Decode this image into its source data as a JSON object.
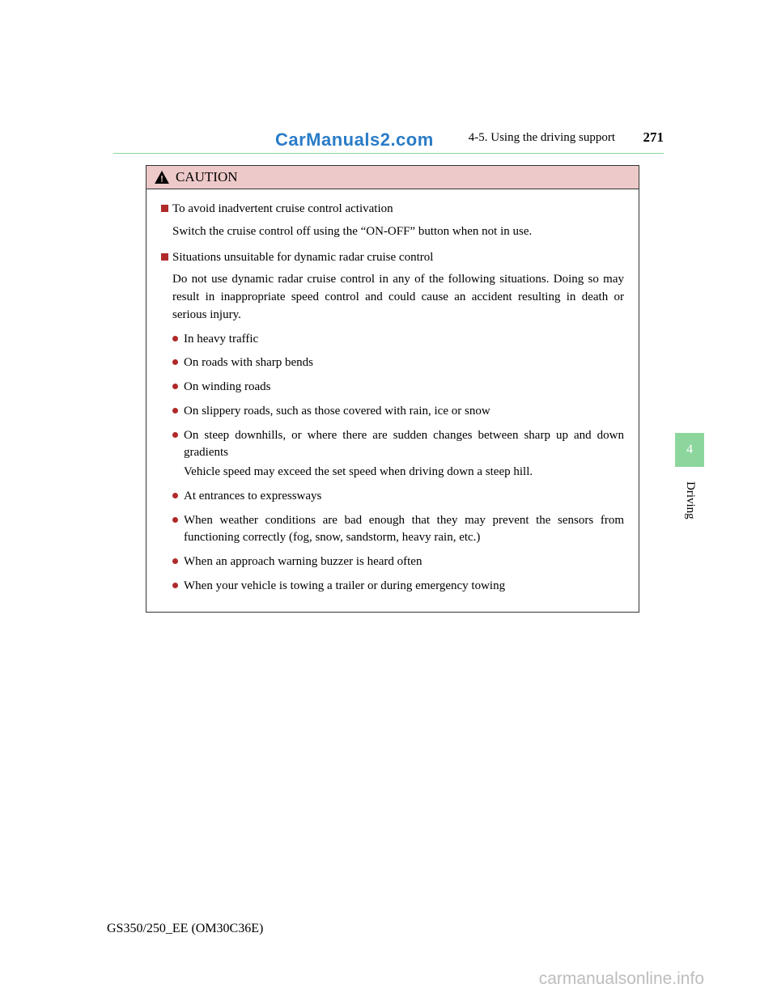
{
  "header": {
    "watermark": "CarManuals2.com",
    "section": "4-5. Using the driving support",
    "page_number": "271"
  },
  "caution": {
    "title": "CAUTION",
    "sections": [
      {
        "heading": "To avoid inadvertent cruise control activation",
        "paragraph": "Switch the cruise control off using the “ON-OFF” button when not in use."
      },
      {
        "heading": "Situations unsuitable for dynamic radar cruise control",
        "paragraph": "Do not use dynamic radar cruise control in any of the following situations. Doing so may result in inappropriate speed control and could cause an accident resulting in death or serious injury.",
        "bullets": [
          {
            "text": "In heavy traffic"
          },
          {
            "text": "On roads with sharp bends"
          },
          {
            "text": "On winding roads"
          },
          {
            "text": "On slippery roads, such as those covered with rain, ice or snow"
          },
          {
            "text": "On steep downhills, or where there are sudden changes between sharp up and down gradients",
            "sub": "Vehicle speed may exceed the set speed when driving down a steep hill."
          },
          {
            "text": "At entrances to expressways"
          },
          {
            "text": "When weather conditions are bad enough that they may prevent the sensors from functioning correctly (fog, snow, sandstorm, heavy rain, etc.)"
          },
          {
            "text": "When an approach warning buzzer is heard often"
          },
          {
            "text": "When your vehicle is towing a trailer or during emergency towing"
          }
        ]
      }
    ]
  },
  "side": {
    "chapter": "4",
    "label": "Driving"
  },
  "footer": {
    "code": "GS350/250_EE (OM30C36E)",
    "site": "carmanualsonline.info"
  }
}
